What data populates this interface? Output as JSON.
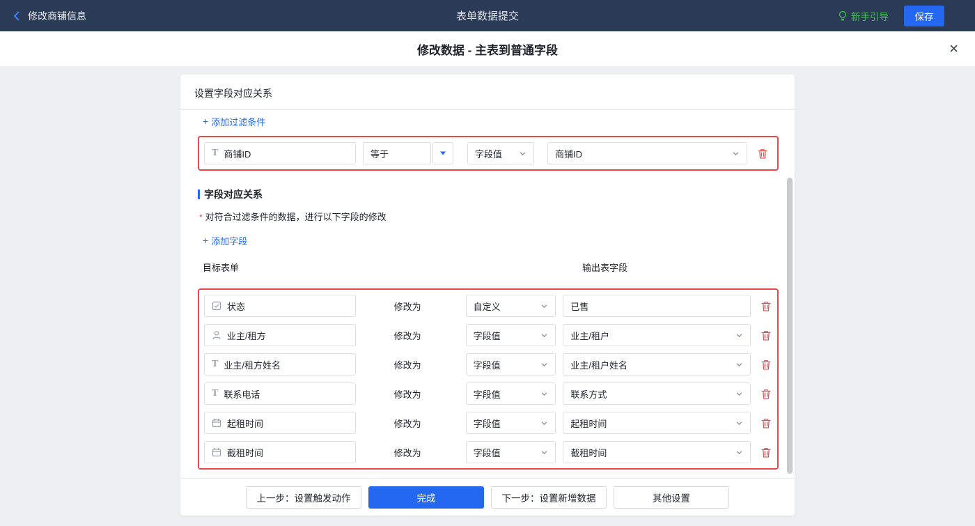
{
  "icons": {
    "plus": "+",
    "close": "×",
    "text_field": "T"
  },
  "topbar": {
    "back_label": "修改商铺信息",
    "title": "表单数据提交",
    "guide_label": "新手引导",
    "save_label": "保存"
  },
  "dialog": {
    "title": "修改数据 - 主表到普通字段"
  },
  "panel": {
    "header": "设置字段对应关系",
    "add_filter_label": "添加过滤条件",
    "filter": {
      "field": "商铺ID",
      "operator": "等于",
      "value_type": "字段值",
      "value": "商铺ID"
    },
    "mapping_section": {
      "title": "字段对应关系",
      "required_mark": "*",
      "note": "对符合过滤条件的数据，进行以下字段的修改",
      "add_field_label": "添加字段",
      "column_left": "目标表单",
      "column_right": "输出表字段"
    },
    "rows": [
      {
        "icon": "select-field",
        "target": "状态",
        "action": "修改为",
        "type": "自定义",
        "value": "已售"
      },
      {
        "icon": "person",
        "target": "业主/租方",
        "action": "修改为",
        "type": "字段值",
        "value": "业主/租户"
      },
      {
        "icon": "text",
        "target": "业主/租方姓名",
        "action": "修改为",
        "type": "字段值",
        "value": "业主/租户姓名"
      },
      {
        "icon": "text",
        "target": "联系电话",
        "action": "修改为",
        "type": "字段值",
        "value": "联系方式"
      },
      {
        "icon": "calendar",
        "target": "起租时间",
        "action": "修改为",
        "type": "字段值",
        "value": "起租时间"
      },
      {
        "icon": "calendar",
        "target": "截租时间",
        "action": "修改为",
        "type": "字段值",
        "value": "截租时间"
      }
    ],
    "footer": {
      "prev_label": "上一步：设置触发动作",
      "finish_label": "完成",
      "next_label": "下一步：设置新增数据",
      "other_label": "其他设置"
    }
  }
}
